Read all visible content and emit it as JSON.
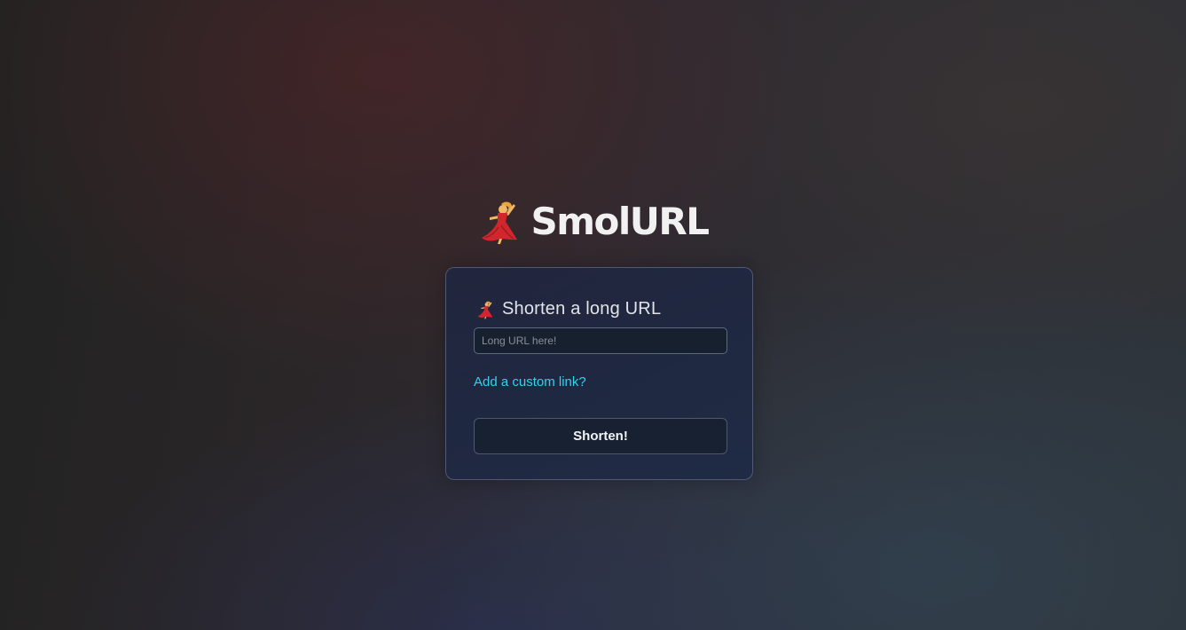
{
  "header": {
    "logo_icon": "dancer-emoji-icon",
    "brand": "SmolURL"
  },
  "card": {
    "heading_icon": "dancer-emoji-icon",
    "heading": "Shorten a long URL",
    "url_input": {
      "value": "",
      "placeholder": "Long URL here!"
    },
    "custom_link_label": "Add a custom link?",
    "submit_label": "Shorten!"
  },
  "colors": {
    "link": "#2fd4ee",
    "card_background": "#1e2a46",
    "button_background": "#182131",
    "dancer_dress": "#d2262e",
    "dancer_hair": "#e8a63a"
  }
}
